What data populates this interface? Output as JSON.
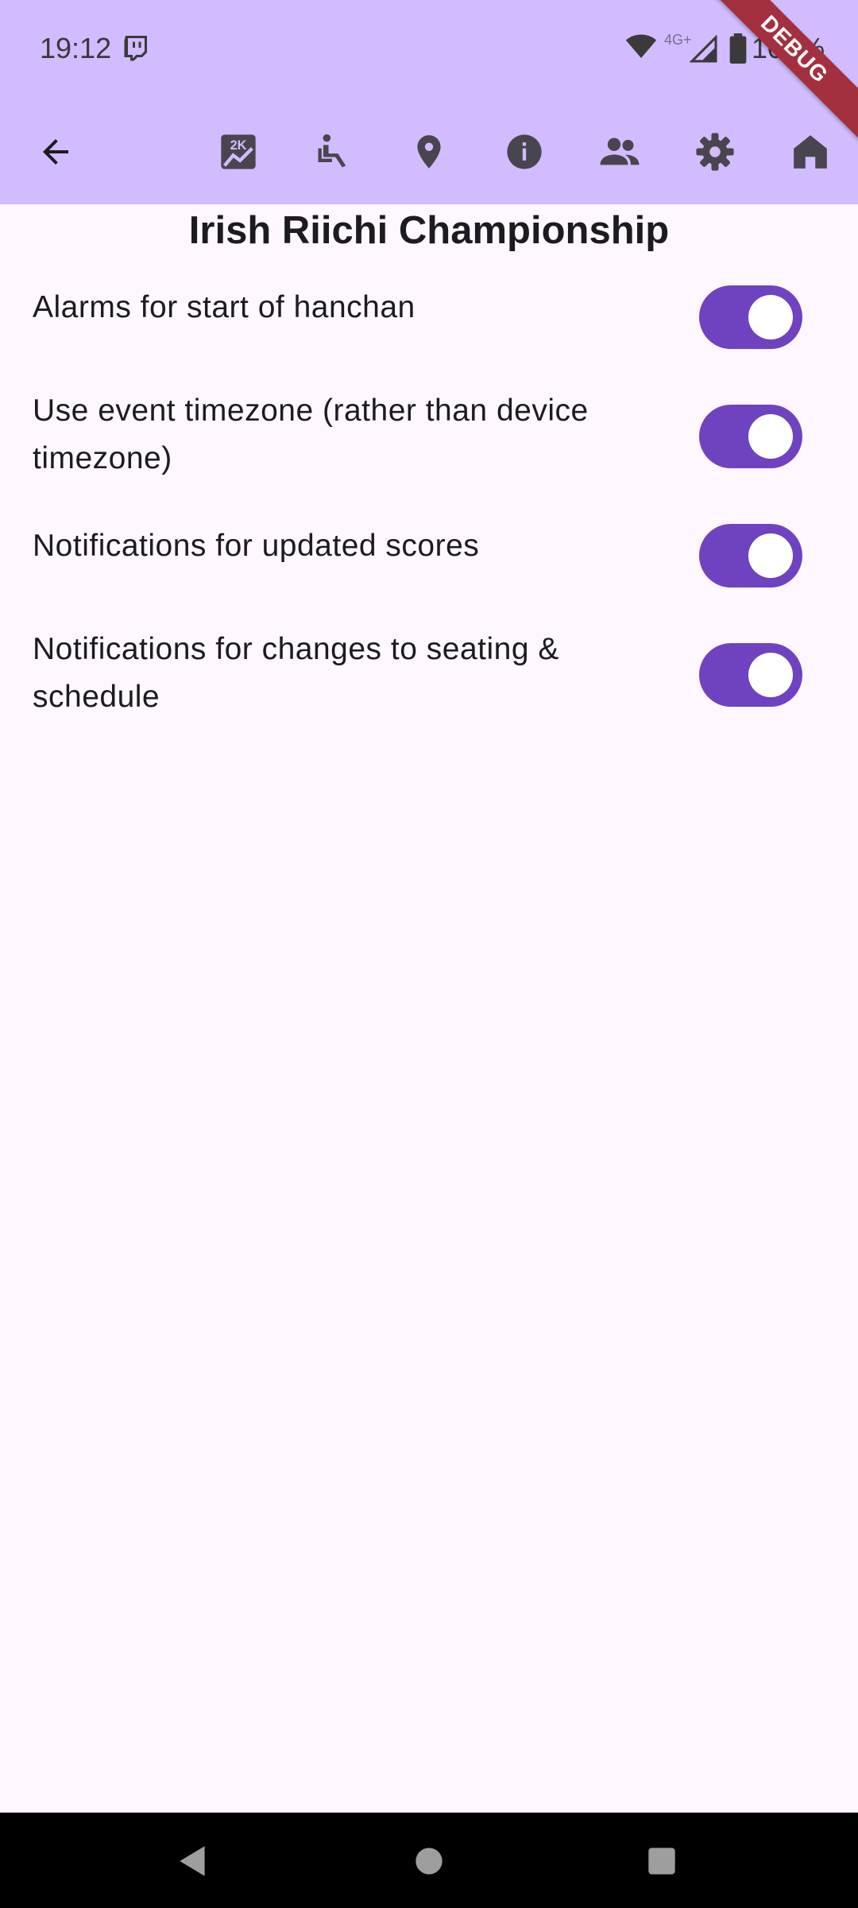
{
  "status_bar": {
    "time": "19:12",
    "battery": "100%",
    "network_badge": "4G+"
  },
  "debug_banner": "DEBUG",
  "page": {
    "title": "Irish Riichi Championship"
  },
  "toolbar": {
    "icons": [
      "back-arrow-icon",
      "scores-chart-icon",
      "seating-icon",
      "location-icon",
      "info-icon",
      "players-icon",
      "settings-icon",
      "home-icon"
    ]
  },
  "settings": [
    {
      "label": "Alarms for start of hanchan",
      "enabled": true
    },
    {
      "label": "Use event timezone (rather than device timezone)",
      "enabled": true
    },
    {
      "label": "Notifications for updated scores",
      "enabled": true
    },
    {
      "label": "Notifications for changes to seating & schedule",
      "enabled": true
    }
  ],
  "colors": {
    "app_bar": "#d0bcff",
    "switch_track": "#6f43c0",
    "background": "#fef7ff",
    "debug_ribbon": "#a4303f"
  }
}
